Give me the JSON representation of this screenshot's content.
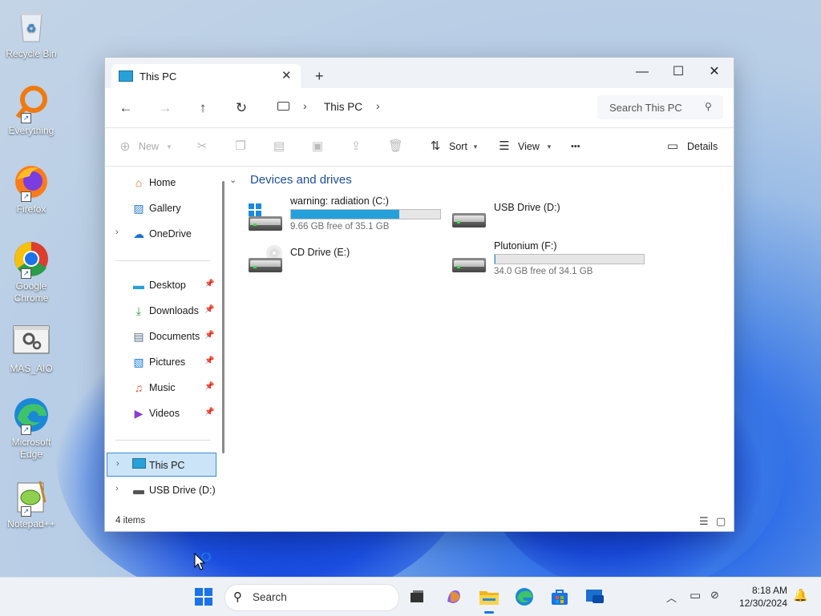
{
  "desktop": {
    "icons": [
      {
        "label": "Recycle Bin"
      },
      {
        "label": "Everything"
      },
      {
        "label": "Firefox"
      },
      {
        "label": "Google Chrome"
      },
      {
        "label": "MAS_AIO"
      },
      {
        "label": "Microsoft Edge"
      },
      {
        "label": "Notepad++"
      }
    ]
  },
  "window": {
    "tab_title": "This PC",
    "tab_close": "✕",
    "new_tab": "+",
    "controls": {
      "minimize": "—",
      "maximize": "☐",
      "close": "✕"
    }
  },
  "nav": {
    "back": "←",
    "forward": "→",
    "up": "↑",
    "refresh": "↻",
    "separator": "›",
    "breadcrumb": "This PC",
    "search_placeholder": "Search This PC",
    "search_icon": "⚲"
  },
  "commands": {
    "new_label": "New",
    "sort_label": "Sort",
    "view_label": "View",
    "more_label": "•••",
    "details_label": "Details"
  },
  "sidebar": {
    "quick": [
      {
        "label": "Home",
        "icon": "home-icon"
      },
      {
        "label": "Gallery",
        "icon": "gallery-icon"
      },
      {
        "label": "OneDrive",
        "icon": "cloud-icon"
      }
    ],
    "pinned": [
      {
        "label": "Desktop",
        "icon": "desktop-icon"
      },
      {
        "label": "Downloads",
        "icon": "download-icon"
      },
      {
        "label": "Documents",
        "icon": "document-icon"
      },
      {
        "label": "Pictures",
        "icon": "picture-icon"
      },
      {
        "label": "Music",
        "icon": "music-icon"
      },
      {
        "label": "Videos",
        "icon": "video-icon"
      }
    ],
    "places": [
      {
        "label": "This PC",
        "icon": "computer-icon",
        "selected": true
      },
      {
        "label": "USB Drive (D:)",
        "icon": "usb-drive-icon"
      }
    ]
  },
  "content": {
    "group_title": "Devices and drives",
    "drives": [
      {
        "name": "warning: radiation (C:)",
        "free_text": "9.66 GB free of 35.1 GB",
        "used_fraction": 0.725,
        "icon": "windows-drive-icon"
      },
      {
        "name": "USB Drive (D:)",
        "icon": "usb-drive-icon"
      },
      {
        "name": "CD Drive (E:)",
        "icon": "cd-drive-icon"
      },
      {
        "name": "Plutonium (F:)",
        "free_text": "34.0 GB free of 34.1 GB",
        "used_fraction": 0.003,
        "icon": "hard-drive-icon"
      }
    ]
  },
  "status": {
    "items_count": "4 items"
  },
  "taskbar": {
    "search_placeholder": "Search",
    "clock_time": "8:18 AM",
    "clock_date": "12/30/2024",
    "accent": "#1a73e8"
  }
}
